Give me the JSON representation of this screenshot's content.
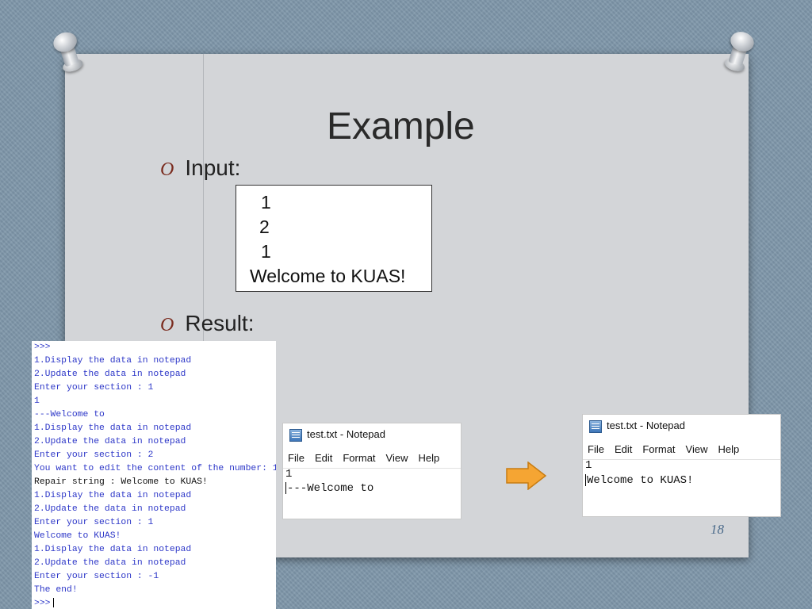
{
  "slide": {
    "title": "Example",
    "page_number": "18",
    "bullet_mark": "O",
    "input_label": "Input:",
    "result_label": "Result:"
  },
  "input_box": {
    "lines": [
      "1",
      "2",
      "1",
      "Welcome to KUAS!"
    ]
  },
  "console": {
    "lines": [
      ">>>",
      "1.Display the data in notepad",
      "2.Update the data in notepad",
      "Enter your section : 1",
      "1",
      "---Welcome to",
      "1.Display the data in notepad",
      "2.Update the data in notepad",
      "Enter your section : 2",
      "You want to edit the content of the number: 1",
      "Repair string : Welcome to KUAS!",
      "1.Display the data in notepad",
      "2.Update the data in notepad",
      "Enter your section : 1",
      "Welcome to KUAS!",
      "1.Display the data in notepad",
      "2.Update the data in notepad",
      "Enter your section : -1",
      "The end!",
      ">>>"
    ],
    "colors": {
      "prompt": "#2d37c8",
      "output": "#111111"
    }
  },
  "notepad_before": {
    "title": "test.txt - Notepad",
    "menu": [
      "File",
      "Edit",
      "Format",
      "View",
      "Help"
    ],
    "lines": [
      "1",
      "---Welcome to"
    ]
  },
  "notepad_after": {
    "title": "test.txt - Notepad",
    "menu": [
      "File",
      "Edit",
      "Format",
      "View",
      "Help"
    ],
    "lines": [
      "1",
      "Welcome to KUAS!"
    ]
  },
  "arrow_color": "#f5a533"
}
